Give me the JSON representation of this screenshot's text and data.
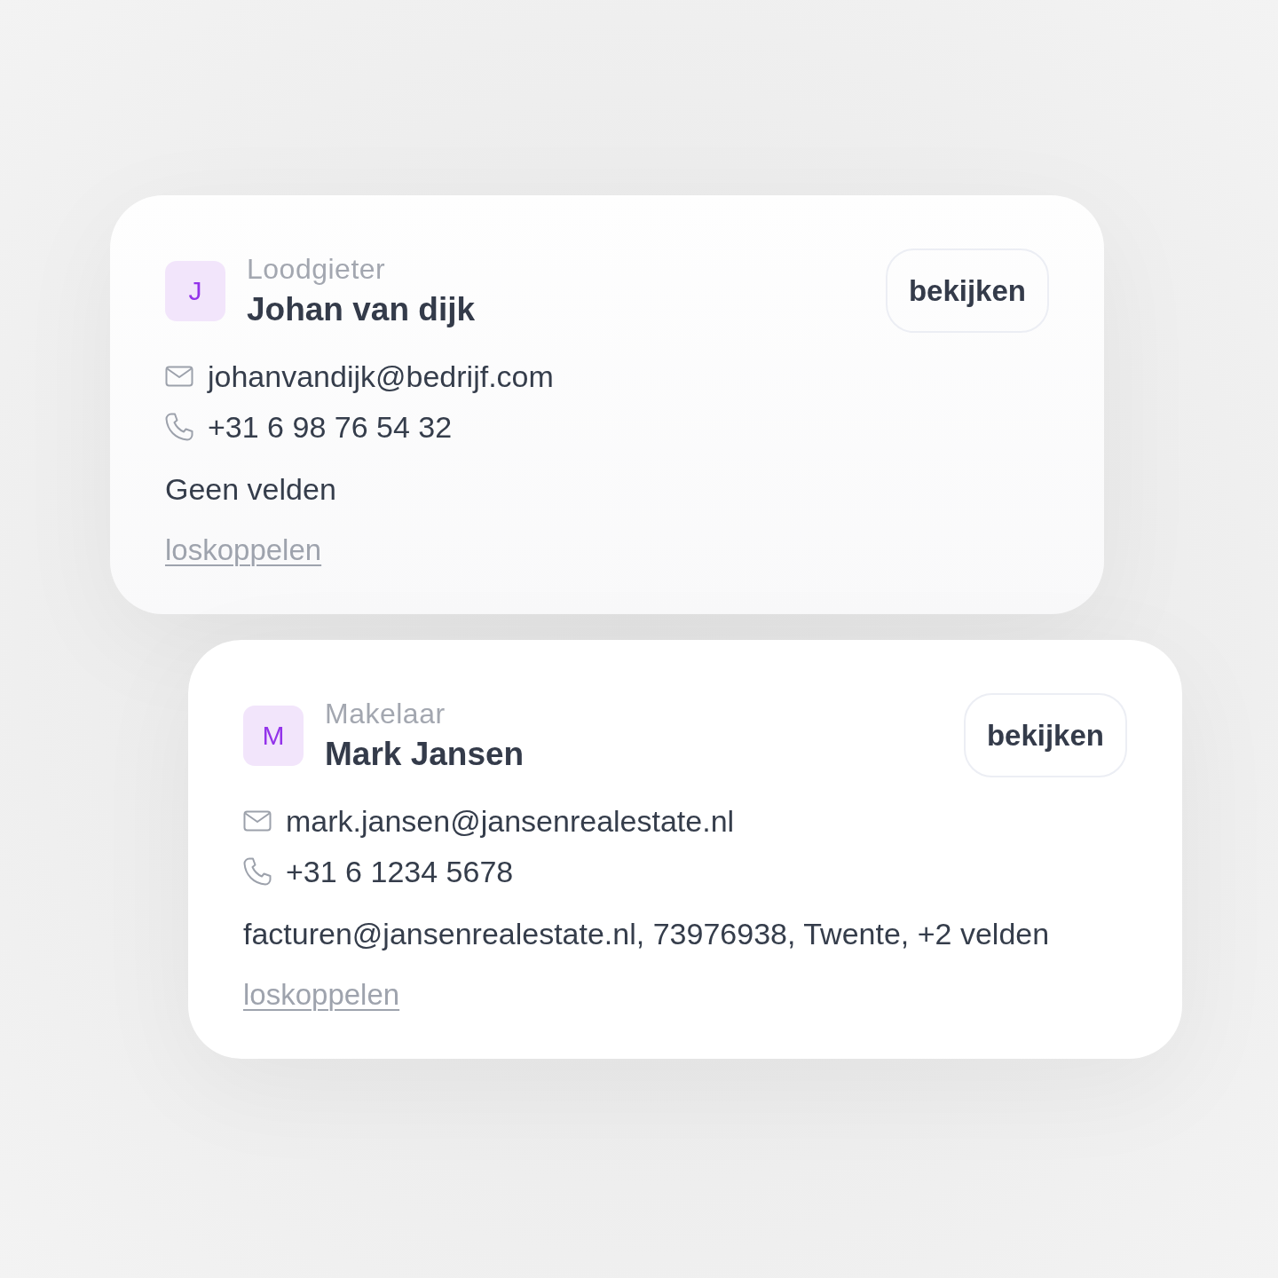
{
  "contacts": [
    {
      "initial": "J",
      "role": "Loodgieter",
      "name": "Johan van dijk",
      "view_button": "bekijken",
      "email": "johanvandijk@bedrijf.com",
      "phone": "+31 6 98 76 54 32",
      "fields": "Geen velden",
      "unlink_link": "loskoppelen"
    },
    {
      "initial": "M",
      "role": "Makelaar",
      "name": "Mark Jansen",
      "view_button": "bekijken",
      "email": "mark.jansen@jansenrealestate.nl",
      "phone": "+31 6 1234 5678",
      "fields": "facturen@jansenrealestate.nl, 73976938, Twente, +2 velden",
      "unlink_link": "loskoppelen"
    }
  ]
}
